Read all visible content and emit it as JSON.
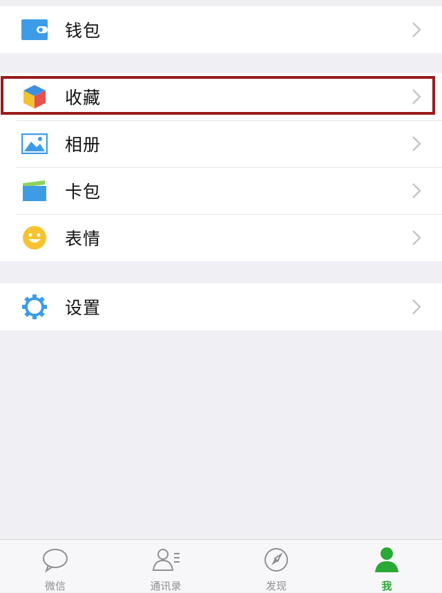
{
  "groups": {
    "wallet": {
      "items": [
        {
          "label": "钱包",
          "icon": "wallet-icon"
        }
      ]
    },
    "main": {
      "items": [
        {
          "label": "收藏",
          "icon": "favorites-cube-icon"
        },
        {
          "label": "相册",
          "icon": "album-picture-icon"
        },
        {
          "label": "卡包",
          "icon": "card-package-icon"
        },
        {
          "label": "表情",
          "icon": "smiley-icon"
        }
      ]
    },
    "settings": {
      "items": [
        {
          "label": "设置",
          "icon": "gear-icon"
        }
      ]
    }
  },
  "tabbar": {
    "tabs": [
      {
        "label": "微信",
        "icon": "chat-bubble-icon",
        "active": false
      },
      {
        "label": "通讯录",
        "icon": "contacts-icon",
        "active": false
      },
      {
        "label": "发现",
        "icon": "compass-icon",
        "active": false
      },
      {
        "label": "我",
        "icon": "person-icon",
        "active": true
      }
    ]
  },
  "colors": {
    "background": "#efeff4",
    "highlight": "#9b1c1c",
    "accent_green": "#2aa836",
    "icon_blue": "#3e9ce6"
  }
}
